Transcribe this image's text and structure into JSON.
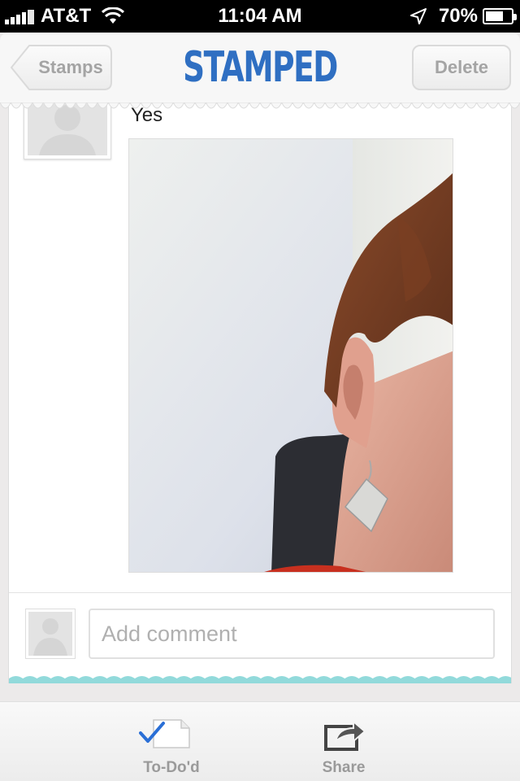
{
  "status_bar": {
    "carrier": "AT&T",
    "time": "11:04 AM",
    "battery_percent": "70%",
    "battery_level": 0.7
  },
  "nav": {
    "back_label": "Stamps",
    "title": "STAMPED",
    "delete_label": "Delete"
  },
  "post": {
    "text": "Yes"
  },
  "comment": {
    "placeholder": "Add comment"
  },
  "tabs": [
    {
      "label": "To-Do'd",
      "icon": "todo-check-icon"
    },
    {
      "label": "Share",
      "icon": "share-icon"
    }
  ],
  "colors": {
    "brand": "#2f6fc2",
    "check": "#2a6fd6",
    "wave": "#7fd3d5"
  }
}
